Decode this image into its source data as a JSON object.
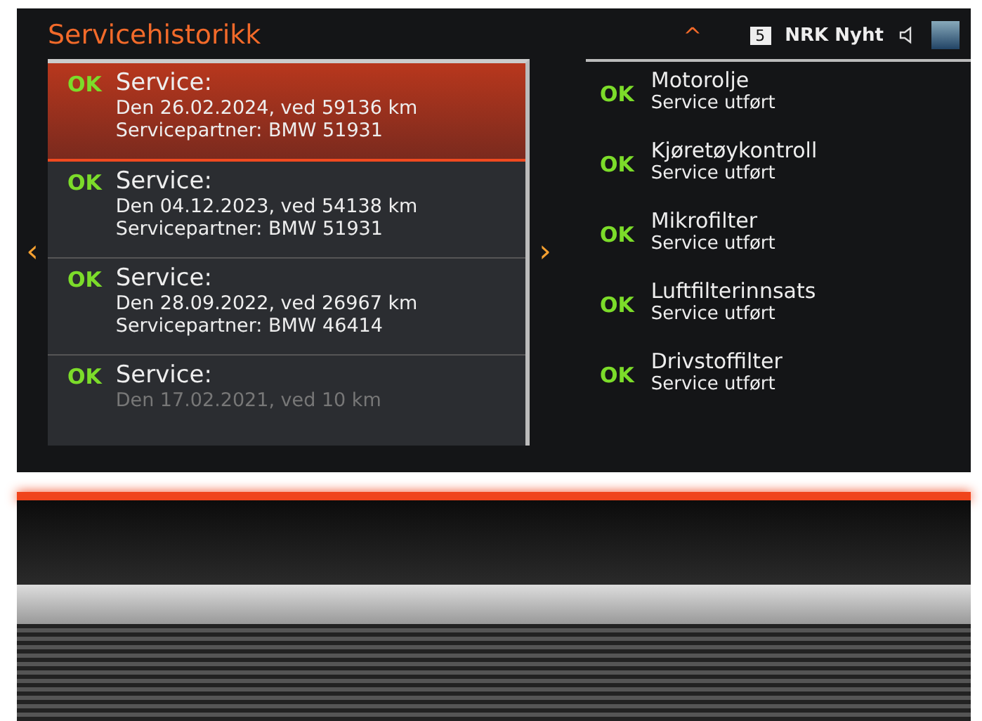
{
  "header": {
    "title": "Servicehistorikk",
    "up_arrow": "^",
    "preset": "5",
    "station": "NRK Nyht"
  },
  "nav": {
    "left": "‹",
    "right": "›"
  },
  "history": [
    {
      "status": "OK",
      "title": "Service:",
      "date_line": "Den 26.02.2024, ved 59136 km",
      "partner_line": "Servicepartner: BMW 51931",
      "selected": true
    },
    {
      "status": "OK",
      "title": "Service:",
      "date_line": "Den 04.12.2023, ved 54138 km",
      "partner_line": "Servicepartner: BMW 51931",
      "selected": false
    },
    {
      "status": "OK",
      "title": "Service:",
      "date_line": "Den 28.09.2022, ved 26967 km",
      "partner_line": "Servicepartner: BMW 46414",
      "selected": false
    },
    {
      "status": "OK",
      "title": "Service:",
      "date_line": "Den 17.02.2021, ved 10 km",
      "selected": false
    }
  ],
  "details": [
    {
      "status": "OK",
      "name": "Motorolje",
      "state": "Service utført"
    },
    {
      "status": "OK",
      "name": "Kjøretøykontroll",
      "state": "Service utført"
    },
    {
      "status": "OK",
      "name": "Mikrofilter",
      "state": "Service utført"
    },
    {
      "status": "OK",
      "name": "Luftfilterinnsats",
      "state": "Service utført"
    },
    {
      "status": "OK",
      "name": "Drivstoffilter",
      "state": "Service utført"
    }
  ]
}
